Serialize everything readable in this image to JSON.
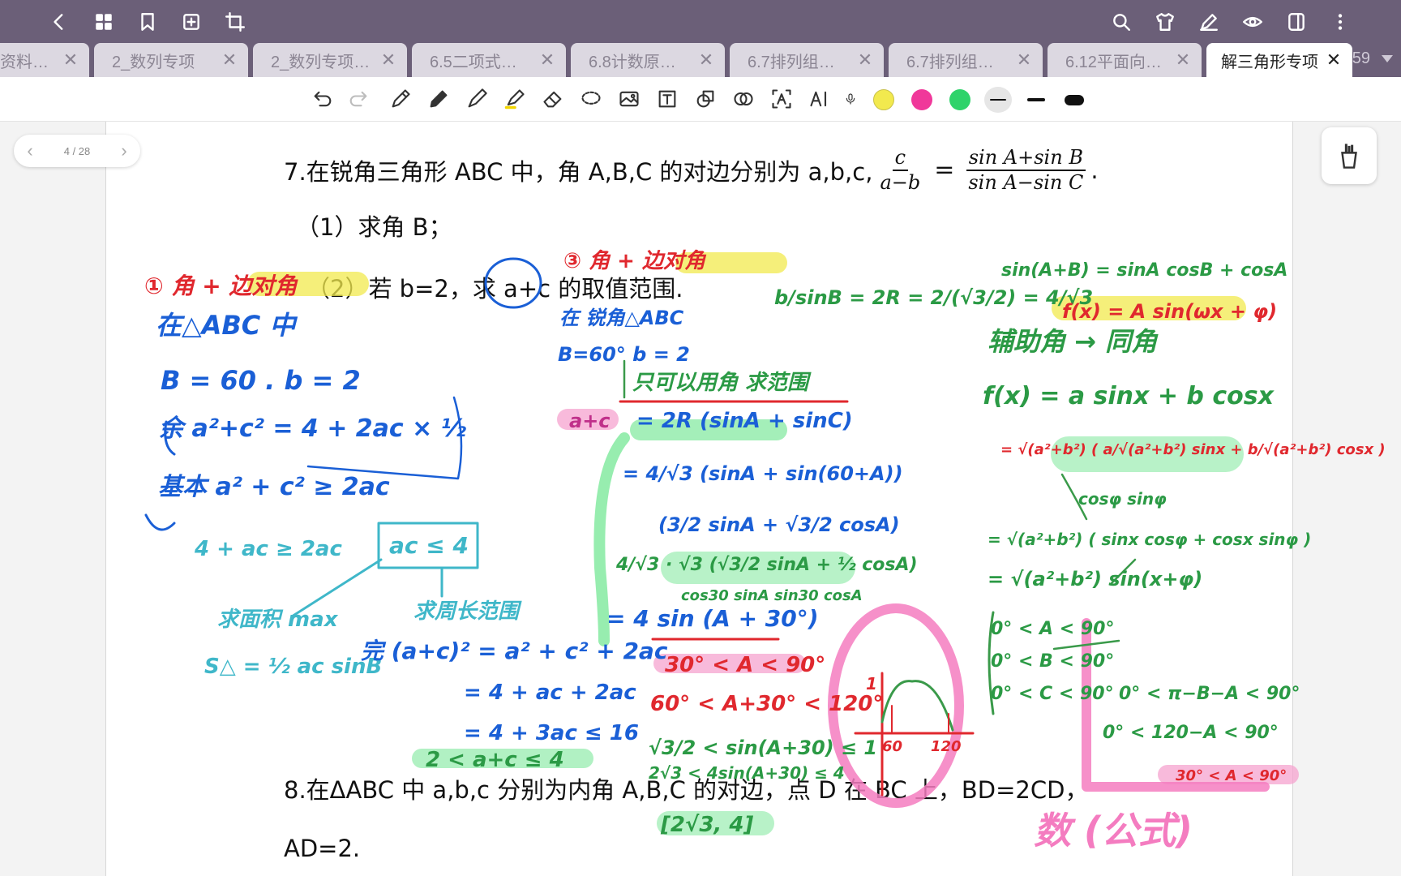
{
  "tabs": [
    {
      "label": "资料_…",
      "active": false
    },
    {
      "label": "2_数列专项",
      "active": false
    },
    {
      "label": "2_数列专项…",
      "active": false
    },
    {
      "label": "6.5二项式…",
      "active": false
    },
    {
      "label": "6.8计数原…",
      "active": false
    },
    {
      "label": "6.7排列组…",
      "active": false
    },
    {
      "label": "6.7排列组…",
      "active": false
    },
    {
      "label": "6.12平面向…",
      "active": false
    },
    {
      "label": "解三角形专项",
      "active": true
    }
  ],
  "tab_count": "59",
  "pager": {
    "text": "4 / 28"
  },
  "colors": {
    "yellow": "#f2e94e",
    "pink": "#f0389a",
    "green": "#2ed36a",
    "topbar": "#6b5f78"
  },
  "document": {
    "q7_text": "7.在锐角三角形 ABC 中，角 A,B,C 的对边分别为 a,b,c,",
    "q7_frac1_num": "c",
    "q7_frac1_den": "a−b",
    "q7_eq": "=",
    "q7_frac2_num": "sin A+sin B",
    "q7_frac2_den": "sin A−sin C",
    "q7_end": ".",
    "q7_part1": "（1）求角 B；",
    "q7_part2": "（2）若 b=2，求 a+c 的取值范围.",
    "q8_line1": "8.在ΔABC 中 a,b,c 分别为内角 A,B,C 的对边，点 D 在 BC 上，BD=2CD，",
    "q8_line2": "AD=2."
  },
  "handwriting": {
    "red1": "① 角 + 边对角",
    "blue1": "在△ABC 中",
    "blue2": "B = 60 .  b = 2",
    "blue3": "余  a²+c² = 4 + 2ac × ½",
    "blue4": "基本  a² + c² ≥ 2ac",
    "teal1": "4 + ac ≥ 2ac",
    "teal2": "ac ≤ 4",
    "teal3": "求面积 max",
    "teal4": "S△ = ½ ac sinB",
    "teal5": "求周长范围",
    "blue5": "完 (a+c)² = a² + c² + 2ac",
    "blue6": "= 4 + ac + 2ac",
    "blue7": "= 4 + 3ac ≤ 16",
    "green1": "2 < a+c ≤ 4",
    "red2": "③ 角 + 边对角",
    "blue8": "在 锐角△ABC",
    "blue9": "B=60°  b = 2",
    "green2": "只可以用角 求范围",
    "green3": "b/sinB = 2R = 2/(√3/2) = 4/√3",
    "pink1": "a+c",
    "blue10": "= 2R (sinA + sinC)",
    "blue11": "= 4/√3 (sinA + sin(60+A))",
    "blue12": "(3/2 sinA + √3/2 cosA)",
    "green4": "4/√3 · √3 (√3/2 sinA + ½ cosA)",
    "green5": "cos30 sinA  sin30 cosA",
    "blue13": "= 4 sin (A + 30°)",
    "red3": "30° < A < 90°",
    "red4": "60° < A+30° < 120°",
    "green6": "√3/2 < sin(A+30) ≤ 1",
    "green7": "2√3 < 4sin(A+30) ≤ 4",
    "green8": "[2√3, 4]",
    "green9": "sin(A+B) = sinA cosB + cosA",
    "red5": "f(x) = A sin(ωx + φ)",
    "green10": "辅助角 → 同角",
    "green11": "f(x) = a sinx + b cosx",
    "red6": "= √(a²+b²) ( a/√(a²+b²) sinx + b/√(a²+b²) cosx )",
    "green12": "cosφ   sinφ",
    "green13": "= √(a²+b²) ( sinx cosφ + cosx sinφ )",
    "green14": "= √(a²+b²) sin(x+φ)",
    "green15": "0° < A < 90°",
    "green16": "0° < B < 90°",
    "green17": "0° < C < 90°",
    "green18": "0° < π−B−A < 90°",
    "green19": "0° < 120−A < 90°",
    "pink2": "30° < A < 90°",
    "pink3": "数 (公式)",
    "graph1": "1",
    "graph2": "60",
    "graph3": "120"
  }
}
